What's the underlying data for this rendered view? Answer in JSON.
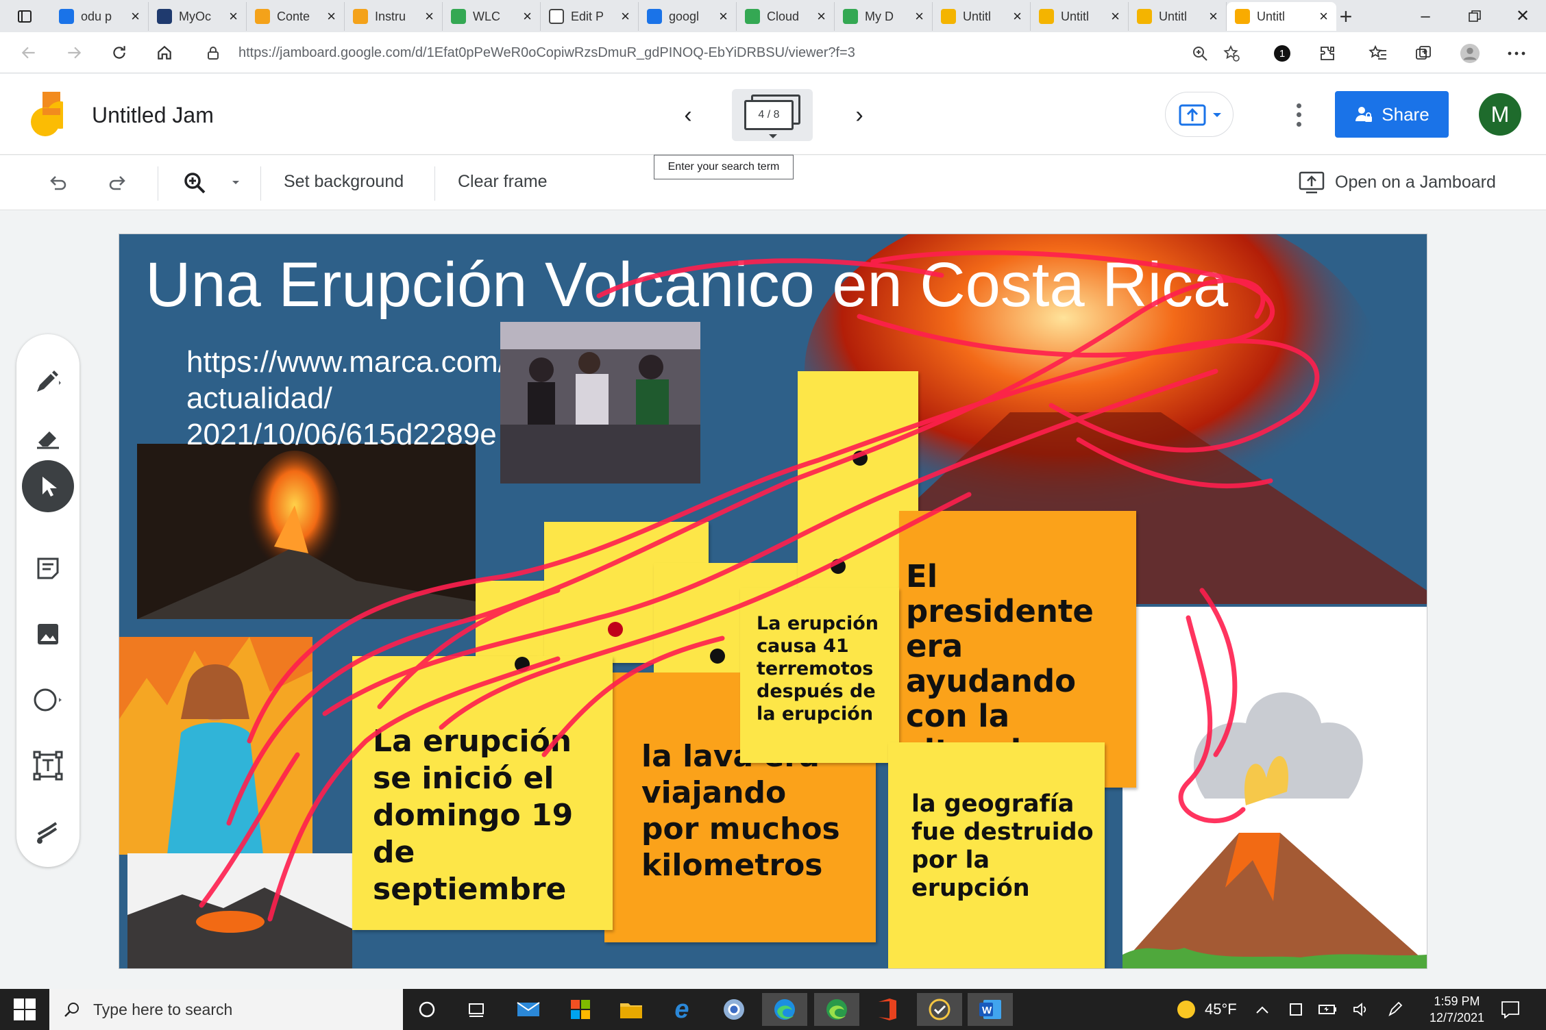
{
  "browser": {
    "tabs": [
      {
        "label": "odu p",
        "icon": "bing-icon",
        "color": "#1a73e8"
      },
      {
        "label": "MyOc",
        "icon": "odu-icon",
        "color": "#1f3a6e"
      },
      {
        "label": "Conte",
        "icon": "slides-draw-icon",
        "color": "#f4a21a"
      },
      {
        "label": "Instru",
        "icon": "slides-draw-icon",
        "color": "#f4a21a"
      },
      {
        "label": "WLC",
        "icon": "drive-icon",
        "color": "#34a853"
      },
      {
        "label": "Edit P",
        "icon": "page-icon",
        "color": "#ffffff"
      },
      {
        "label": "googl",
        "icon": "bing-icon",
        "color": "#1a73e8"
      },
      {
        "label": "Cloud",
        "icon": "drive-icon",
        "color": "#34a853"
      },
      {
        "label": "My D",
        "icon": "drive-icon",
        "color": "#34a853"
      },
      {
        "label": "Untitl",
        "icon": "slides-icon",
        "color": "#f4b400"
      },
      {
        "label": "Untitl",
        "icon": "slides-icon",
        "color": "#f4b400"
      },
      {
        "label": "Untitl",
        "icon": "slides-icon",
        "color": "#f4b400"
      },
      {
        "label": "Untitl",
        "icon": "jamboard-icon",
        "color": "#f9ab00",
        "active": true
      }
    ],
    "url": "https://jamboard.google.com/d/1Efat0pPeWeR0oCopiwRzsDmuR_gdPINOQ-EbYiDRBSU/viewer?f=3",
    "extension_badge": "1"
  },
  "jam": {
    "title": "Untitled Jam",
    "frame_indicator": "4 / 8",
    "search_tooltip": "Enter your search term",
    "share_label": "Share",
    "avatar_letter": "M",
    "accent": "#1a73e8"
  },
  "toolbar": {
    "set_background": "Set background",
    "clear_frame": "Clear frame",
    "open_on_jamboard": "Open on a Jamboard"
  },
  "tools": [
    "pen-icon",
    "eraser-icon",
    "select-icon",
    "sticky-note-icon",
    "image-icon",
    "circle-icon",
    "text-box-icon",
    "laser-icon"
  ],
  "frame": {
    "title": "Una Erupción Volcanico en Costa Rica",
    "url_lines": [
      "https://www.marca.com/",
      "actualidad/",
      "2021/10/06/615d2289e"
    ],
    "stickies": [
      {
        "text": "La erupción se inició el domingo 19 de septiembre",
        "color": "yellow"
      },
      {
        "text": "la lava era viajando por muchos kilometros",
        "color": "orange"
      },
      {
        "text": "La erupción causa 41 terremotos después de la erupción",
        "color": "yellow"
      },
      {
        "text": "El presidente era ayudando con la situacion.",
        "color": "orange"
      },
      {
        "text": "la geografía fue destruido por la erupción",
        "color": "yellow"
      }
    ]
  },
  "taskbar": {
    "search_placeholder": "Type here to search",
    "weather": "45°F",
    "time": "1:59 PM",
    "date": "12/7/2021"
  }
}
